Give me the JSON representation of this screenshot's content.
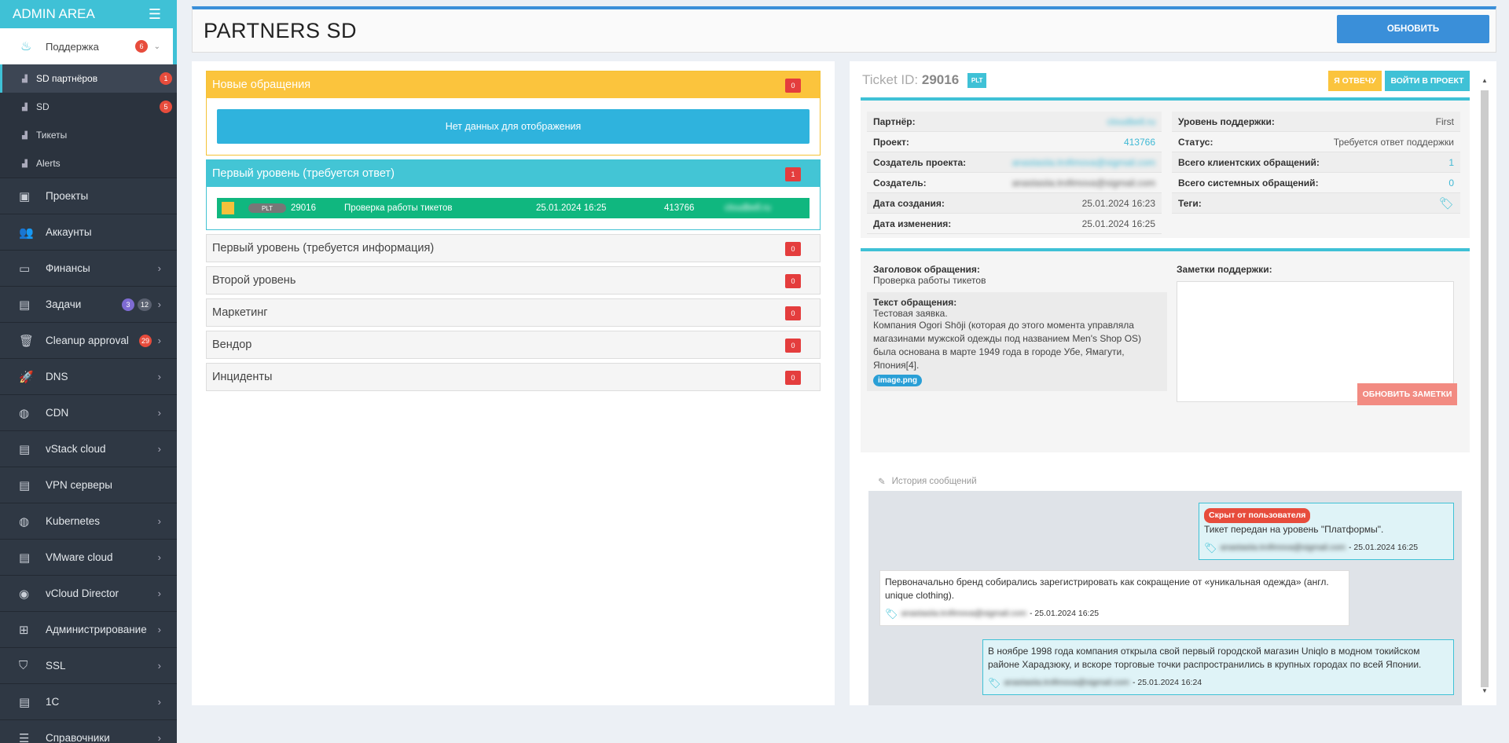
{
  "sidebar": {
    "brand": "ADMIN AREA",
    "active_item": {
      "label": "Поддержка",
      "badge": "6"
    },
    "sub_items": [
      {
        "label": "SD партнёров",
        "badge": "1"
      },
      {
        "label": "SD",
        "badge": "5"
      },
      {
        "label": "Тикеты",
        "badge": ""
      },
      {
        "label": "Alerts",
        "badge": ""
      }
    ],
    "items": [
      {
        "label": "Проекты",
        "icon": "briefcase-icon"
      },
      {
        "label": "Аккаунты",
        "icon": "users-icon"
      },
      {
        "label": "Финансы",
        "icon": "money-icon"
      },
      {
        "label": "Задачи",
        "icon": "book-icon",
        "badges": [
          "3",
          "12"
        ]
      },
      {
        "label": "Cleanup approval",
        "icon": "trash-icon",
        "badges": [
          "29"
        ]
      },
      {
        "label": "DNS",
        "icon": "rocket-icon"
      },
      {
        "label": "CDN",
        "icon": "globe-icon"
      },
      {
        "label": "vStack cloud",
        "icon": "server-icon"
      },
      {
        "label": "VPN серверы",
        "icon": "server-icon"
      },
      {
        "label": "Kubernetes",
        "icon": "globe-icon"
      },
      {
        "label": "VMware cloud",
        "icon": "server-icon"
      },
      {
        "label": "vCloud Director",
        "icon": "podcast-icon"
      },
      {
        "label": "Администрирование",
        "icon": "sitemap-icon"
      },
      {
        "label": "SSL",
        "icon": "shield-icon"
      },
      {
        "label": "1C",
        "icon": "book-icon"
      },
      {
        "label": "Справочники",
        "icon": "list-icon"
      }
    ]
  },
  "header": {
    "title": "PARTNERS SD",
    "refresh_label": "ОБНОВИТЬ"
  },
  "groups": {
    "new": {
      "label": "Новые обращения",
      "count": "0",
      "empty_text": "Нет данных для отображения"
    },
    "first_answer": {
      "label": "Первый уровень (требуется ответ)",
      "count": "1",
      "ticket": {
        "tag": "PLT",
        "id": "29016",
        "subject": "Проверка работы тикетов",
        "date": "25.01.2024 16:25",
        "project": "413766",
        "partner": "cloudbell.ru"
      }
    },
    "first_info": {
      "label": "Первый уровень (требуется информация)",
      "count": "0"
    },
    "second": {
      "label": "Второй уровень",
      "count": "0"
    },
    "marketing": {
      "label": "Маркетинг",
      "count": "0"
    },
    "vendor": {
      "label": "Вендор",
      "count": "0"
    },
    "incidents": {
      "label": "Инциденты",
      "count": "0"
    }
  },
  "ticket": {
    "id_label": "Ticket ID:",
    "id": "29016",
    "tag": "PLT",
    "answer_btn": "Я ОТВЕЧУ",
    "login_btn": "ВОЙТИ В ПРОЕКТ",
    "left_info": [
      {
        "key": "Партнёр:",
        "value": "cloudbell.ru"
      },
      {
        "key": "Проект:",
        "value": "413766"
      },
      {
        "key": "Создатель проекта:",
        "value": "anastasiia.trofimova@sigmail.com"
      },
      {
        "key": "Создатель:",
        "value": "anastasiia.trofimova@sigmail.com"
      },
      {
        "key": "Дата создания:",
        "value": "25.01.2024 16:23"
      },
      {
        "key": "Дата изменения:",
        "value": "25.01.2024 16:25"
      }
    ],
    "right_info": [
      {
        "key": "Уровень поддержки:",
        "value": "First"
      },
      {
        "key": "Статус:",
        "value": "Требуется ответ поддержки"
      },
      {
        "key": "Всего клиентских обращений:",
        "value": "1"
      },
      {
        "key": "Всего системных обращений:",
        "value": "0"
      },
      {
        "key": "Теги:",
        "value": ""
      }
    ],
    "subject_label": "Заголовок обращения:",
    "subject": "Проверка работы тикетов",
    "text_label": "Текст обращения:",
    "text_line1": "Тестовая заявка.",
    "text_body": "Компания Ogori Shōji (которая до этого момента управляла магазинами мужской одежды под названием Men's Shop OS) была основана в марте 1949 года в городе Убе, Ямагути, Япония[4].",
    "attachment": "image.png",
    "notes_label": "Заметки поддержки:",
    "notes_btn": "ОБНОВИТЬ ЗАМЕТКИ"
  },
  "history": {
    "title": "История сообщений",
    "messages": [
      {
        "badge": "Скрыт от пользователя",
        "text": "Тикет передан на уровень \"Платформы\".",
        "author": "anastasiia.trofimova@sigmail.com",
        "time": "- 25.01.2024 16:25"
      },
      {
        "text": "Первоначально бренд собирались зарегистрировать как сокращение от «уникальная одежда» (англ. unique clothing).",
        "author": "anastasiia.trofimova@sigmail.com",
        "time": "- 25.01.2024 16:25"
      },
      {
        "text": "В ноябре 1998 года компания открыла свой первый городской магазин Uniqlo в модном токийском районе Харадзюку, и вскоре торговые точки распространились в крупных городах по всей Японии.",
        "author": "anastasiia.trofimova@sigmail.com",
        "time": "- 25.01.2024 16:24"
      }
    ]
  }
}
